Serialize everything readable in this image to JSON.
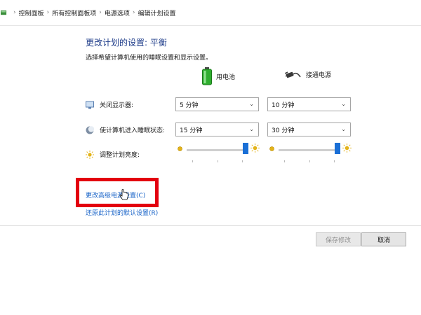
{
  "breadcrumb": {
    "items": [
      "控制面板",
      "所有控制面板项",
      "电源选项",
      "编辑计划设置"
    ],
    "separator": "›"
  },
  "header": {
    "title": "更改计划的设置: 平衡",
    "subtitle": "选择希望计算机使用的睡眠设置和显示设置。"
  },
  "columns": {
    "battery_label": "用电池",
    "plugged_label": "接通电源"
  },
  "rows": {
    "display_off": {
      "label": "关闭显示器:",
      "battery_value": "5 分钟",
      "plugged_value": "10 分钟"
    },
    "sleep": {
      "label": "使计算机进入睡眠状态:",
      "battery_value": "15 分钟",
      "plugged_value": "30 分钟"
    },
    "brightness": {
      "label": "调整计划亮度:",
      "battery_level": 1.0,
      "plugged_level": 1.0
    }
  },
  "links": {
    "advanced": "更改高级电源设置(C)",
    "restore": "还原此计划的默认设置(R)"
  },
  "buttons": {
    "save": "保存修改",
    "cancel": "取消"
  },
  "colors": {
    "title": "#1f3d8a",
    "link": "#1a64c8",
    "highlight": "#e3000f",
    "slider": "#1a6fd6"
  }
}
